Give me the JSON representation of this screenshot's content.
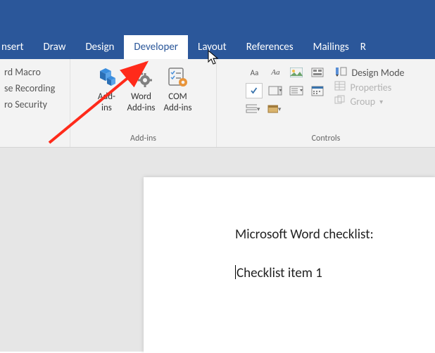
{
  "tabs": {
    "insert": "nsert",
    "draw": "Draw",
    "design": "Design",
    "developer": "Developer",
    "layout": "Layout",
    "references": "References",
    "mailings": "Mailings",
    "review_cut": "R"
  },
  "code_group": {
    "macro": "rd Macro",
    "recording": "se Recording",
    "security": "ro Security"
  },
  "addins": {
    "addins_label": "Add-\nins",
    "word_addins": "Word\nAdd-ins",
    "com_addins": "COM\nAdd-ins",
    "group_label": "Add-ins"
  },
  "controls": {
    "design_mode": "Design Mode",
    "properties": "Properties",
    "group": "Group",
    "group_label": "Controls",
    "aa1": "Aa",
    "aa2": "Aa"
  },
  "doc": {
    "line1": "Microsoft Word checklist:",
    "line2": "Checklist item 1"
  }
}
